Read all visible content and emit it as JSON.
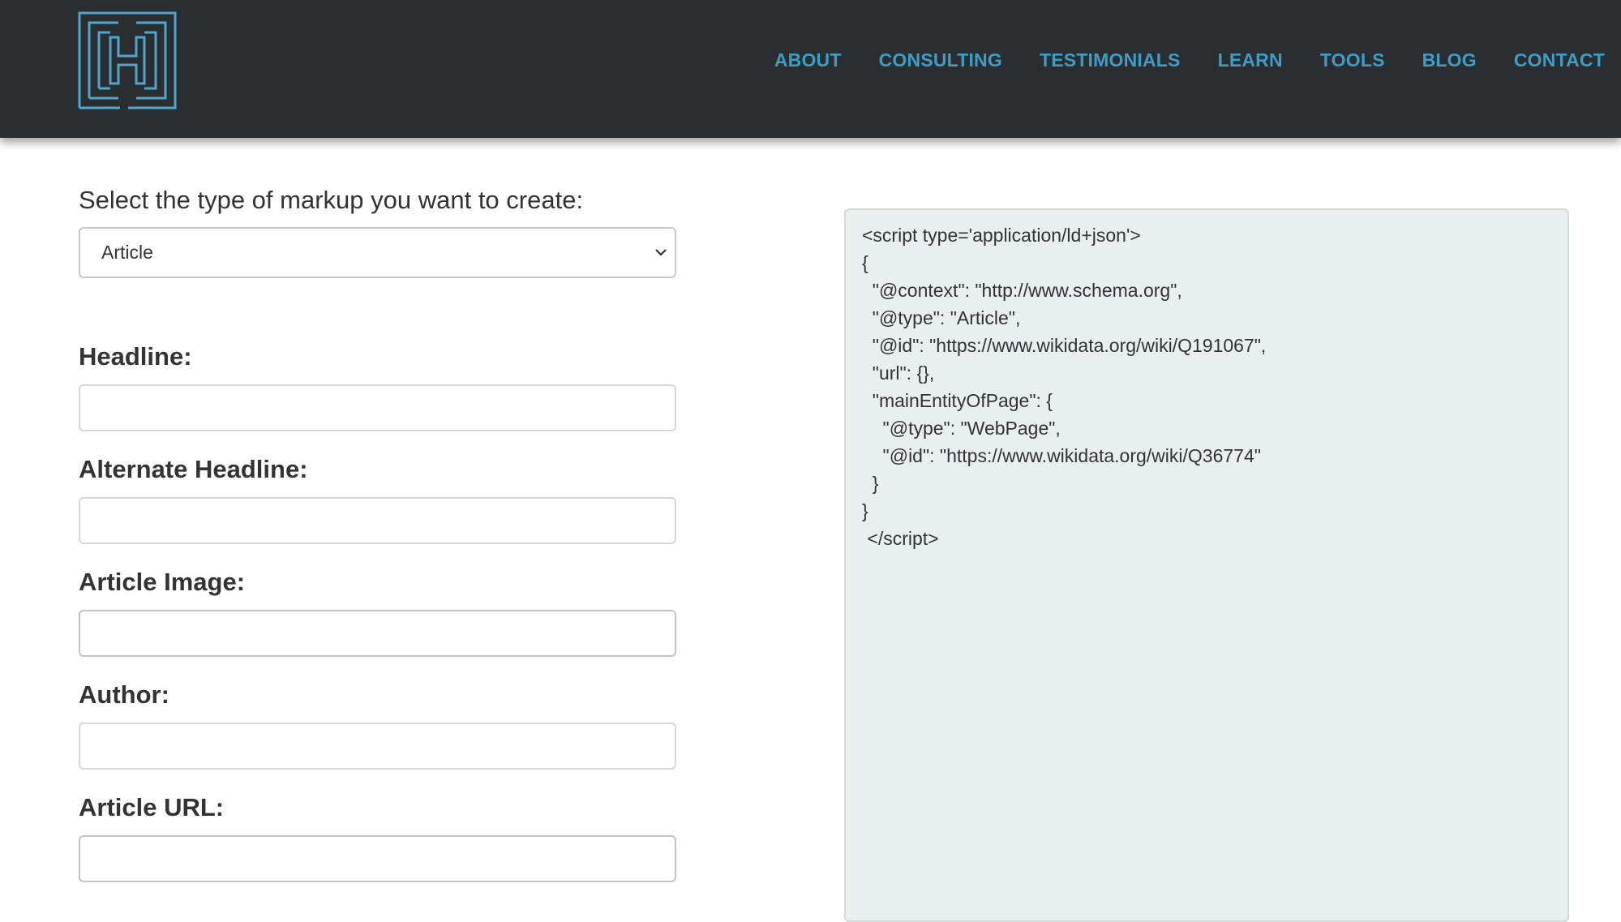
{
  "header": {
    "logo_icon": "h-maze-logo-icon",
    "nav": [
      {
        "label": "ABOUT"
      },
      {
        "label": "CONSULTING"
      },
      {
        "label": "TESTIMONIALS"
      },
      {
        "label": "LEARN"
      },
      {
        "label": "TOOLS"
      },
      {
        "label": "BLOG"
      },
      {
        "label": "CONTACT"
      }
    ]
  },
  "form": {
    "select_label": "Select the type of markup you want to create:",
    "select_value": "Article",
    "fields": [
      {
        "label": "Headline:",
        "value": ""
      },
      {
        "label": "Alternate Headline:",
        "value": ""
      },
      {
        "label": "Article Image:",
        "value": ""
      },
      {
        "label": "Author:",
        "value": ""
      },
      {
        "label": "Article URL:",
        "value": ""
      }
    ]
  },
  "output": {
    "code": "<script type='application/ld+json'>\n{\n  \"@context\": \"http://www.schema.org\",\n  \"@type\": \"Article\",\n  \"@id\": \"https://www.wikidata.org/wiki/Q191067\",\n  \"url\": {},\n  \"mainEntityOfPage\": {\n    \"@type\": \"WebPage\",\n    \"@id\": \"https://www.wikidata.org/wiki/Q36774\"\n  }\n}\n </script>"
  },
  "colors": {
    "header_bg": "#2b2e31",
    "nav_link": "#3d9dc4",
    "logo_stroke": "#4fa6cc",
    "panel_bg": "#e9eeee"
  }
}
